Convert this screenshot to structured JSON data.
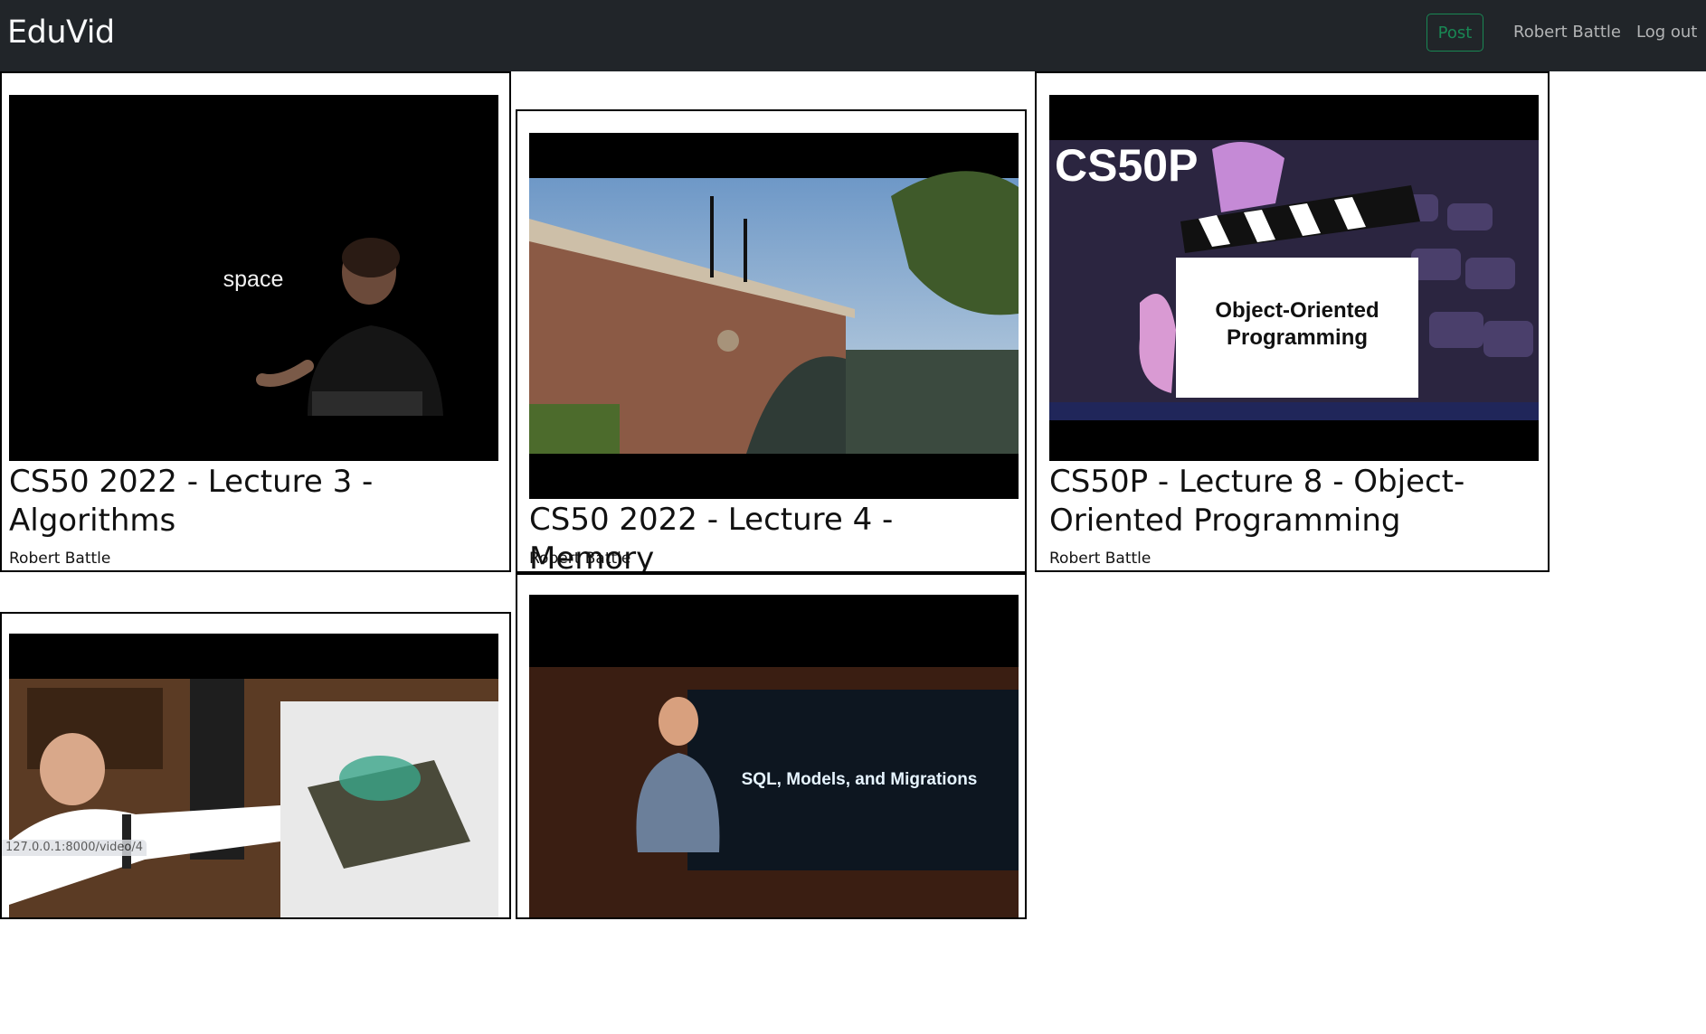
{
  "navbar": {
    "brand": "EduVid",
    "post_label": "Post",
    "user_name": "Robert Battle",
    "logout_label": "Log out"
  },
  "videos": [
    {
      "title": "CS50 2022 - Lecture 3 - Algorithms",
      "author": "Robert Battle",
      "thumb_text": "space"
    },
    {
      "title": "CS50 2022 - Lecture 4 - Memory",
      "author": "Robert Battle"
    },
    {
      "title": "CS50P - Lecture 8 - Object-Oriented Programming",
      "author": "Robert Battle",
      "thumb_text": "CS50P",
      "thumb_sign": [
        "Object-Oriented",
        "Programming"
      ]
    },
    {
      "title": "",
      "author": ""
    },
    {
      "title": "",
      "author": "",
      "thumb_text": "SQL, Models, and Migrations"
    }
  ],
  "status_bar": {
    "url": "127.0.0.1:8000/video/4"
  },
  "colors": {
    "navbar_bg": "#212529",
    "post_green": "#198754"
  }
}
